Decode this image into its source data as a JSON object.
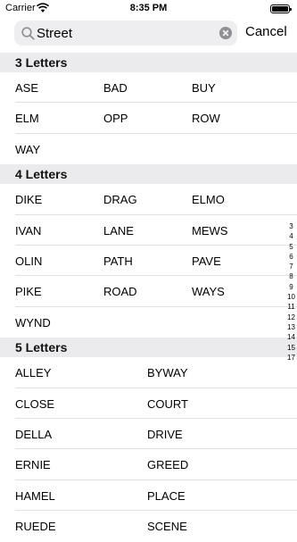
{
  "status_bar": {
    "carrier": "Carrier",
    "time": "8:35 PM"
  },
  "search": {
    "query": "Street",
    "cancel_label": "Cancel"
  },
  "sections": [
    {
      "title": "3 Letters",
      "rows": [
        [
          "ASE",
          "BAD",
          "BUY"
        ],
        [
          "ELM",
          "OPP",
          "ROW"
        ],
        [
          "WAY"
        ]
      ]
    },
    {
      "title": "4 Letters",
      "rows": [
        [
          "DIKE",
          "DRAG",
          "ELMO"
        ],
        [
          "IVAN",
          "LANE",
          "MEWS"
        ],
        [
          "OLIN",
          "PATH",
          "PAVE"
        ],
        [
          "PIKE",
          "ROAD",
          "WAYS"
        ],
        [
          "WYND"
        ]
      ]
    },
    {
      "title": "5 Letters",
      "rows": [
        [
          "ALLEY",
          "BYWAY"
        ],
        [
          "CLOSE",
          "COURT"
        ],
        [
          "DELLA",
          "DRIVE"
        ],
        [
          "ERNIE",
          "GREED"
        ],
        [
          "HAMEL",
          "PLACE"
        ],
        [
          "RUEDE",
          "SCENE"
        ]
      ]
    }
  ],
  "section_index": [
    "3",
    "4",
    "5",
    "6",
    "7",
    "8",
    "9",
    "10",
    "11",
    "12",
    "13",
    "14",
    "15",
    "17"
  ]
}
